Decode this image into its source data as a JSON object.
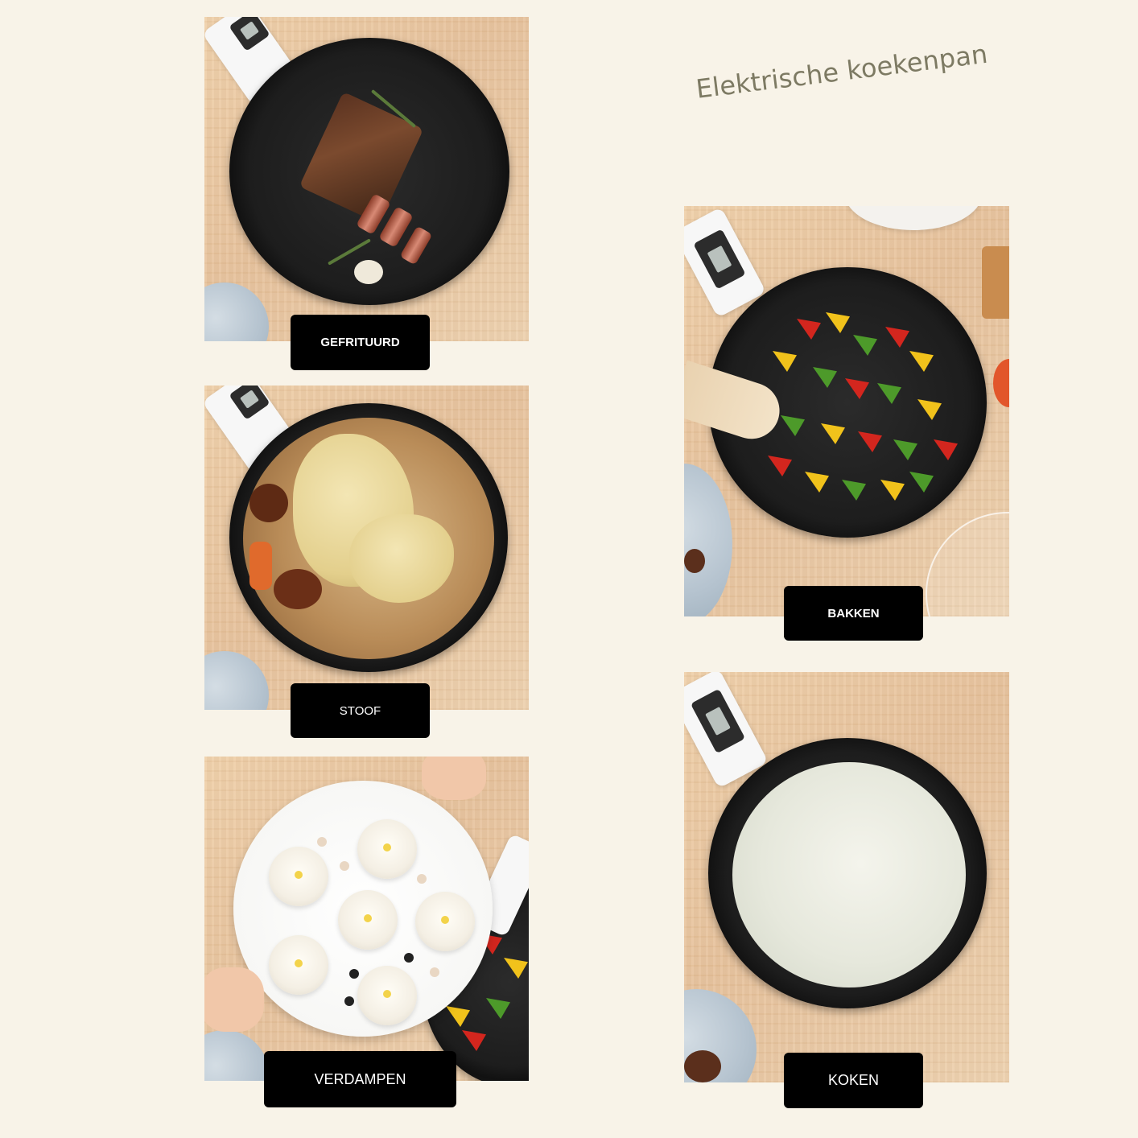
{
  "title": "Elektrische koekenpan",
  "tiles": [
    {
      "id": "fry",
      "label": "GEFRITUURD",
      "food": "steak"
    },
    {
      "id": "stew",
      "label": "STOOF",
      "food": "chicken-soup"
    },
    {
      "id": "steam",
      "label": "VERDAMPEN",
      "food": "dumplings"
    },
    {
      "id": "bake",
      "label": "BAKKEN",
      "food": "bell-peppers"
    },
    {
      "id": "cook",
      "label": "KOKEN",
      "food": "porridge"
    }
  ],
  "colors": {
    "background": "#f8f3e8",
    "title": "#7d7a63",
    "label_bg": "#000000",
    "label_text": "#ffffff",
    "pan": "#1d1d1d"
  }
}
